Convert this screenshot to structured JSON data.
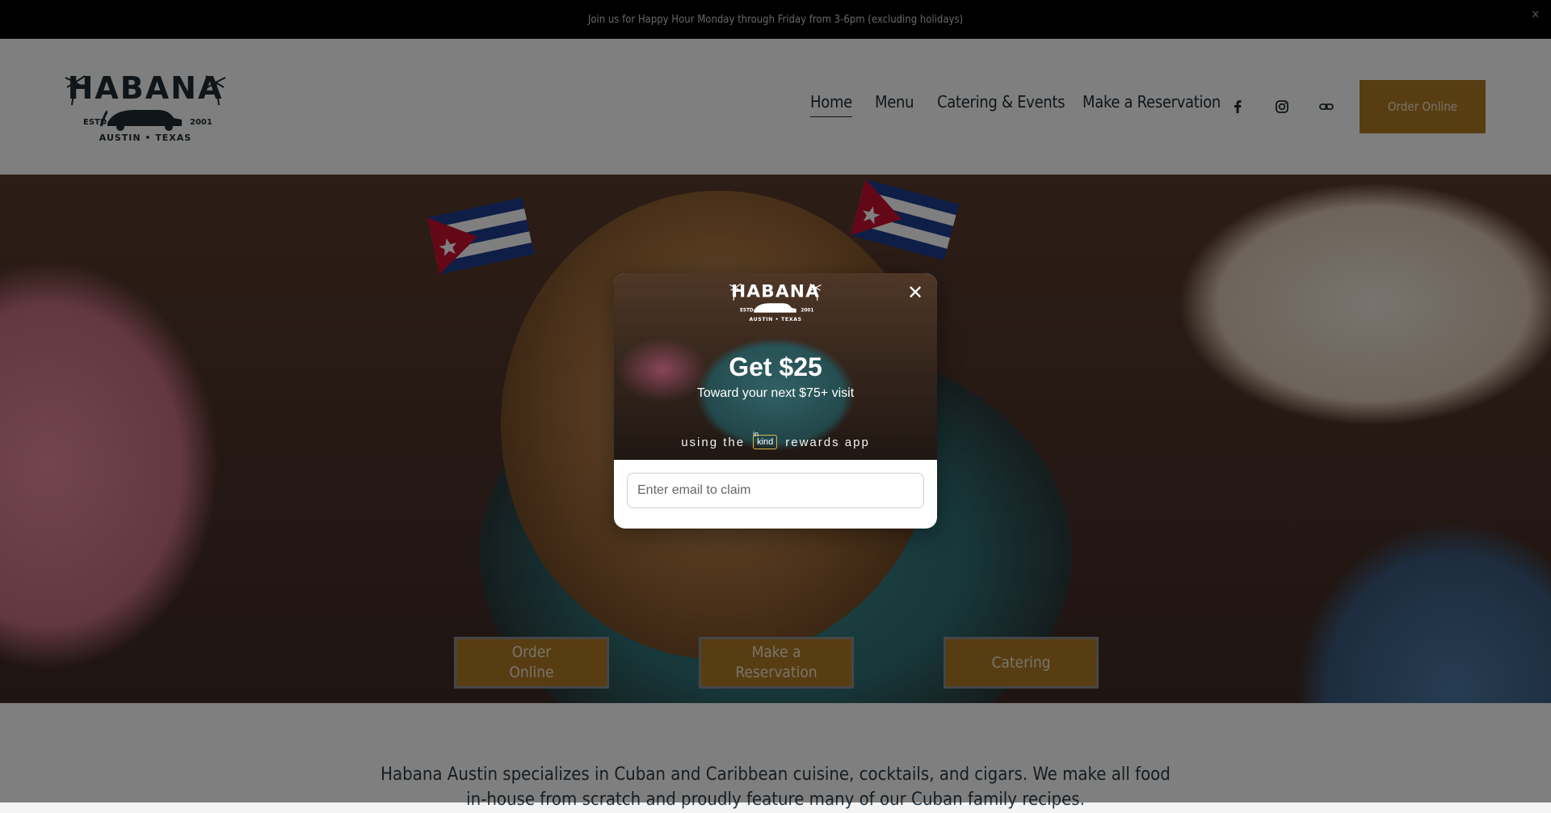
{
  "announcement": {
    "text": "Join us for Happy Hour Monday through Friday from 3-6pm (excluding holidays)",
    "close_glyph": "×"
  },
  "header": {
    "logo": {
      "wordmark": "HABANA",
      "est_label": "ESTD",
      "year": "2001",
      "location": "AUSTIN • TEXAS"
    },
    "nav": [
      {
        "label": "Home",
        "active": true
      },
      {
        "label": "Menu",
        "active": false
      },
      {
        "label": "Catering & Events",
        "active": false
      },
      {
        "label": "Make a Reservation",
        "active": false
      }
    ],
    "social_icons": [
      "facebook-icon",
      "instagram-icon",
      "link-icon"
    ],
    "order_button": "Order Online"
  },
  "hero": {
    "buttons": [
      {
        "label": "Order Online"
      },
      {
        "label": "Make a Reservation"
      },
      {
        "label": "Catering"
      }
    ]
  },
  "about": {
    "text": "Habana Austin specializes in Cuban and Caribbean cuisine, cocktails, and cigars. We make all food in-house from scratch and proudly feature many of our Cuban family recipes."
  },
  "modal": {
    "close_glyph": "✕",
    "title": "Get $25",
    "subtitle": "Toward your next $75+ visit",
    "using_prefix": "using the",
    "app_badge_top": "in",
    "app_badge": "kind",
    "using_suffix": "rewards app",
    "email_placeholder": "Enter email to claim"
  },
  "colors": {
    "accent": "#b07a26",
    "announcement_bg": "#000000",
    "text_dark": "#1f2a33"
  }
}
